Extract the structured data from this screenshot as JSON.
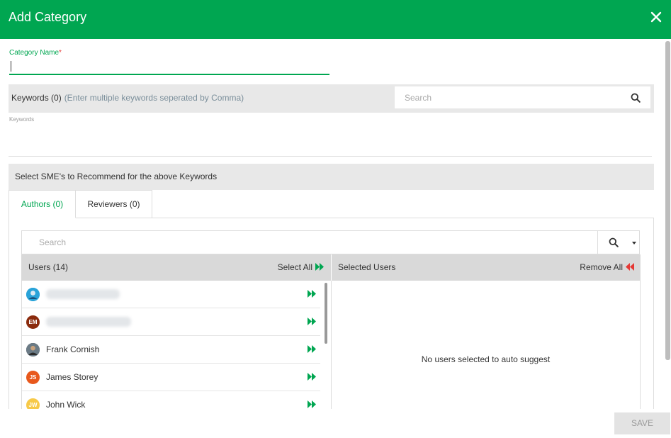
{
  "header": {
    "title": "Add Category"
  },
  "category": {
    "label": "Category Name",
    "required_mark": "*",
    "value": ""
  },
  "keywords": {
    "label": "Keywords (0)",
    "hint": "(Enter multiple keywords seperated by Comma)",
    "search_placeholder": "Search",
    "small_label": "Keywords"
  },
  "sme": {
    "heading": "Select SME's to Recommend for the above Keywords"
  },
  "tabs": [
    {
      "label": "Authors (0)",
      "active": true
    },
    {
      "label": "Reviewers (0)",
      "active": false
    }
  ],
  "users_panel": {
    "search_placeholder": "Search",
    "users_heading": "Users",
    "users_count": "(14)",
    "select_all": "Select All",
    "selected_heading": "Selected Users",
    "remove_all": "Remove All",
    "empty_message": "No users selected to auto suggest"
  },
  "users": [
    {
      "name": "",
      "initials": "",
      "avatar_color": "#29a3d9",
      "avatar_type": "photo-icon"
    },
    {
      "name": "",
      "initials": "EM",
      "avatar_color": "#8b2b0d",
      "avatar_type": "initials"
    },
    {
      "name": "Frank Cornish",
      "initials": "",
      "avatar_color": "#4a4a4a",
      "avatar_type": "photo-icon"
    },
    {
      "name": "James Storey",
      "initials": "JS",
      "avatar_color": "#e8581c",
      "avatar_type": "initials"
    },
    {
      "name": "John Wick",
      "initials": "JW",
      "avatar_color": "#f7c948",
      "avatar_type": "initials"
    }
  ],
  "footer": {
    "save_label": "SAVE"
  },
  "colors": {
    "accent": "#00a651",
    "remove": "#e53935"
  }
}
